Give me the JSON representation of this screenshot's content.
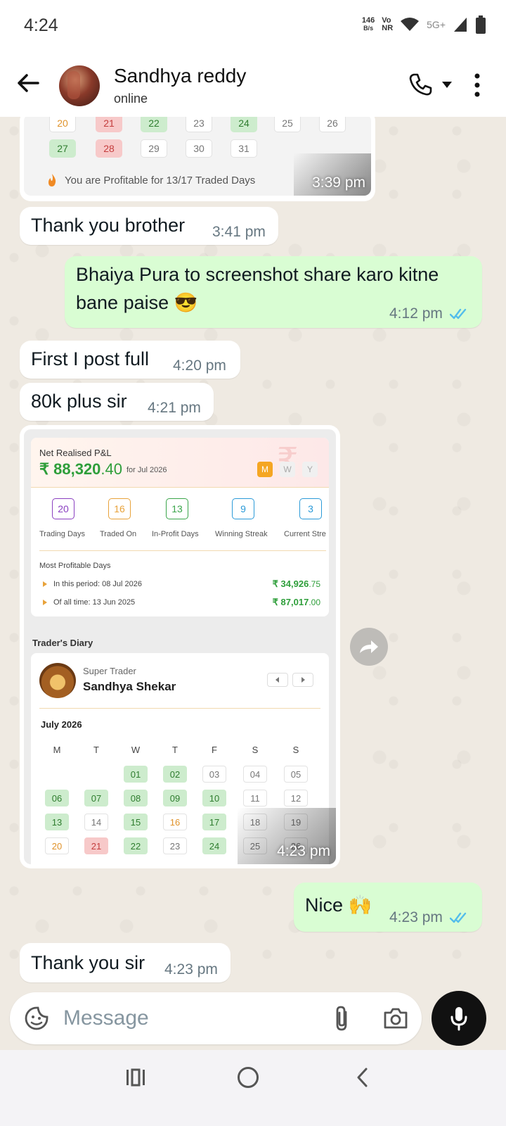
{
  "status": {
    "time": "4:24",
    "net_speed_value": "146",
    "net_speed_unit": "B/s",
    "volte_top": "Vo",
    "volte_bottom": "NR",
    "network": "5G+"
  },
  "header": {
    "contact_name": "Sandhya reddy",
    "contact_status": "online"
  },
  "calendar_snippet": {
    "row1": [
      {
        "d": "20",
        "s": "o"
      },
      {
        "d": "21",
        "s": "r"
      },
      {
        "d": "22",
        "s": "g"
      },
      {
        "d": "23",
        "s": ""
      },
      {
        "d": "24",
        "s": "g"
      },
      {
        "d": "25",
        "s": ""
      },
      {
        "d": "26",
        "s": ""
      }
    ],
    "row2": [
      {
        "d": "27",
        "s": "g"
      },
      {
        "d": "28",
        "s": "r"
      },
      {
        "d": "29",
        "s": ""
      },
      {
        "d": "30",
        "s": ""
      },
      {
        "d": "31",
        "s": ""
      }
    ],
    "profitable_text": "You are Profitable for 13/17 Traded Days",
    "time": "3:39 pm"
  },
  "messages": {
    "m1": {
      "text": "Thank you  brother",
      "time": "3:41 pm"
    },
    "m2": {
      "text_line1": "Bhaiya Pura to screenshot share karo kitne",
      "text_line2": "bane paise 😎",
      "time": "4:12 pm"
    },
    "m3": {
      "text": "First I post full",
      "time": "4:20 pm"
    },
    "m4": {
      "text": "80k plus sir",
      "time": "4:21 pm"
    },
    "m5": {
      "time": "4:23 pm"
    },
    "m6": {
      "text": "Nice 🙌",
      "time": "4:23 pm"
    },
    "m7": {
      "text": "Thank you sir",
      "time": "4:23 pm"
    }
  },
  "pnl": {
    "label": "Net Realised P&L",
    "value_main": "₹ 88,320",
    "value_dec": ".40",
    "period": "for Jul 2026",
    "segments": [
      "M",
      "W",
      "Y"
    ],
    "rupee_mark": "₹",
    "stats": [
      {
        "value": "20",
        "label": "Trading Days",
        "color": "#8a3fc0"
      },
      {
        "value": "16",
        "label": "Traded On",
        "color": "#e8a23a"
      },
      {
        "value": "13",
        "label": "In-Profit Days",
        "color": "#3aa54a"
      },
      {
        "value": "9",
        "label": "Winning Streak",
        "color": "#2b9ad8"
      },
      {
        "value": "3",
        "label": "Current Stre",
        "color": "#2b9ad8"
      }
    ],
    "most_profitable_title": "Most Profitable Days",
    "mpd_period_label": "In this period: 08 Jul 2026",
    "mpd_period_amt": "₹ 34,926",
    "mpd_period_dec": ".75",
    "mpd_all_label": "Of all time: 13 Jun 2025",
    "mpd_all_amt": "₹ 87,017",
    "mpd_all_dec": ".00"
  },
  "diary": {
    "title": "Trader's Diary",
    "role": "Super Trader",
    "name": "Sandhya Shekar",
    "month": "July 2026",
    "dow": [
      "M",
      "T",
      "W",
      "T",
      "F",
      "S",
      "S"
    ],
    "weeks": [
      [
        {
          "d": "",
          "s": ""
        },
        {
          "d": "",
          "s": ""
        },
        {
          "d": "01",
          "s": "g"
        },
        {
          "d": "02",
          "s": "g"
        },
        {
          "d": "03",
          "s": ""
        },
        {
          "d": "04",
          "s": ""
        },
        {
          "d": "05",
          "s": ""
        }
      ],
      [
        {
          "d": "06",
          "s": "g"
        },
        {
          "d": "07",
          "s": "g"
        },
        {
          "d": "08",
          "s": "g"
        },
        {
          "d": "09",
          "s": "g"
        },
        {
          "d": "10",
          "s": "g"
        },
        {
          "d": "11",
          "s": ""
        },
        {
          "d": "12",
          "s": ""
        }
      ],
      [
        {
          "d": "13",
          "s": "g"
        },
        {
          "d": "14",
          "s": ""
        },
        {
          "d": "15",
          "s": "g"
        },
        {
          "d": "16",
          "s": "o"
        },
        {
          "d": "17",
          "s": "g"
        },
        {
          "d": "18",
          "s": ""
        },
        {
          "d": "19",
          "s": ""
        }
      ],
      [
        {
          "d": "20",
          "s": "o"
        },
        {
          "d": "21",
          "s": "r"
        },
        {
          "d": "22",
          "s": "g"
        },
        {
          "d": "23",
          "s": ""
        },
        {
          "d": "24",
          "s": "g"
        },
        {
          "d": "25",
          "s": ""
        },
        {
          "d": "26",
          "s": ""
        }
      ]
    ]
  },
  "input": {
    "placeholder": "Message"
  },
  "colors": {
    "accent_tick": "#53bdeb",
    "outgoing_bubble": "#d9fdd3",
    "profit_green": "#2e9e3a"
  }
}
